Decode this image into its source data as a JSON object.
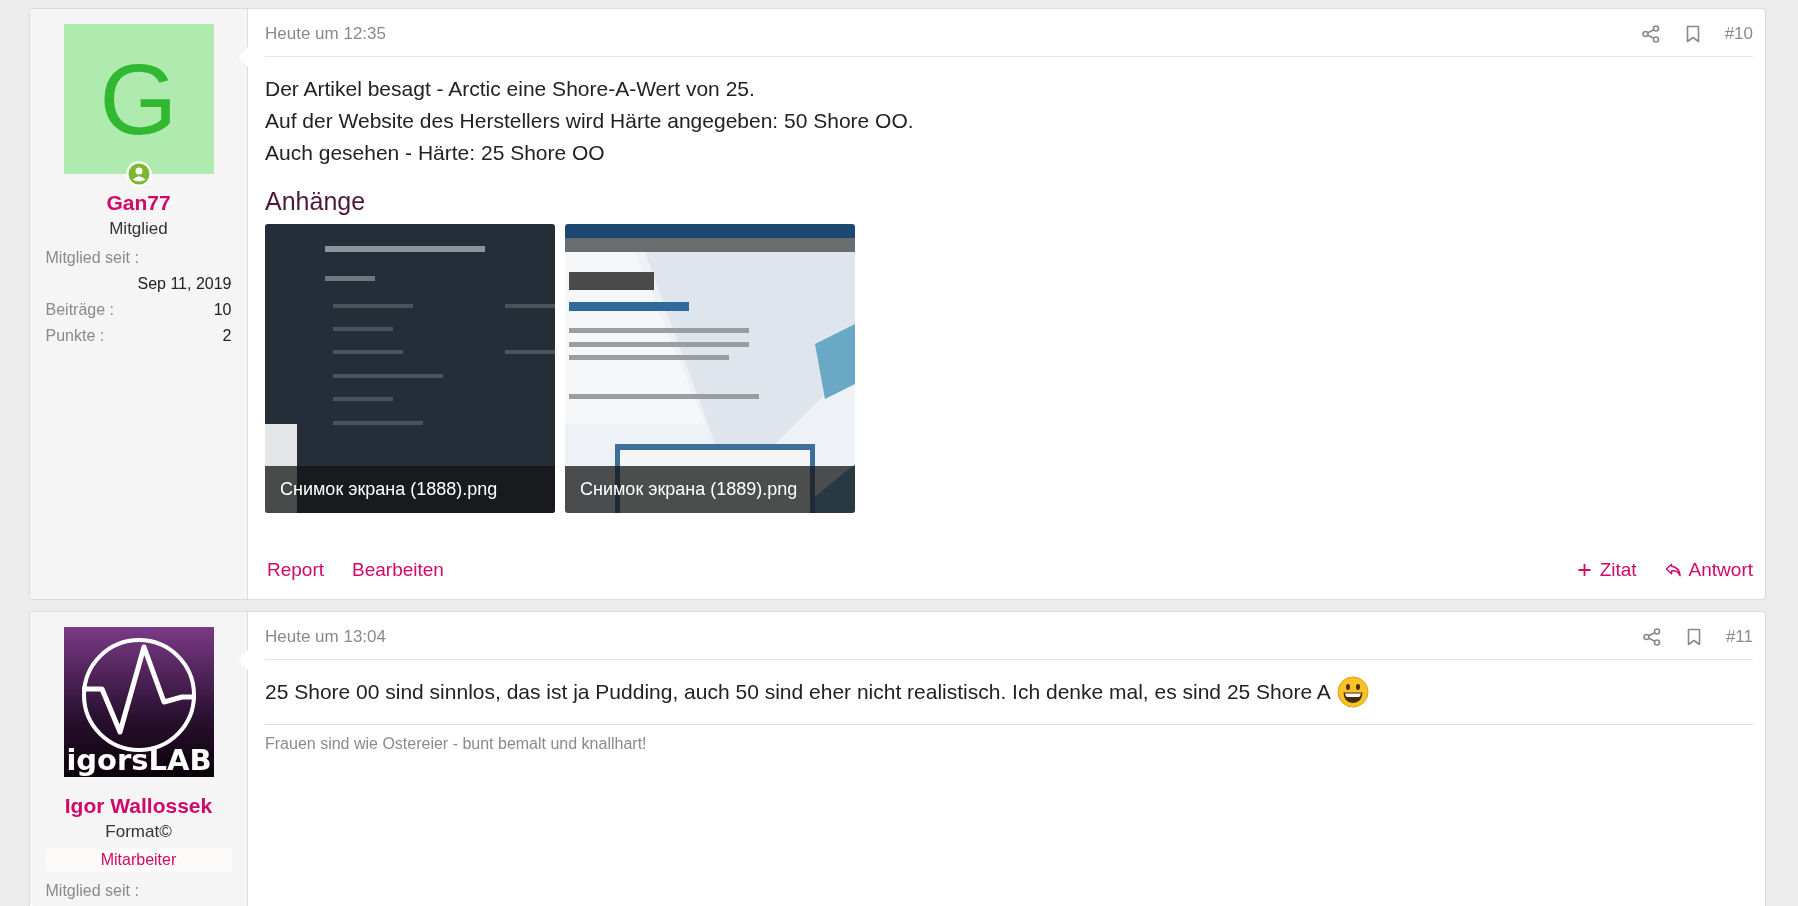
{
  "posts": [
    {
      "author": {
        "avatar": {
          "kind": "letter",
          "letter": "G",
          "online": true
        },
        "name": "Gan77",
        "title": "Mitglied",
        "stats": [
          {
            "label": "Mitglied seit :",
            "value": "Sep 11, 2019",
            "kind": "wide"
          },
          {
            "label": "Beiträge :",
            "value": "10",
            "kind": "inline"
          },
          {
            "label": "Punkte :",
            "value": "2",
            "kind": "inline"
          }
        ]
      },
      "time": "Heute um 12:35",
      "number": "#10",
      "paragraphs": [
        "Der Artikel besagt - Arctic eine Shore-A-Wert von 25.",
        "Auf der Website des Herstellers wird Härte angegeben: 50 Shore OO.",
        "Auch gesehen - Härte: 25 Shore OO"
      ],
      "attachments": {
        "heading": "Anhänge",
        "items": [
          {
            "name": "Снимок экрана (1888).png",
            "kind": "picture"
          },
          {
            "name": "Снимок экрана (1889).png",
            "kind": "picture"
          }
        ]
      },
      "actions_left": [
        "Report",
        "Bearbeiten"
      ],
      "actions_right": [
        {
          "label": "Zitat",
          "kind": "quote"
        },
        {
          "label": "Antwort",
          "kind": "reply"
        }
      ]
    },
    {
      "author": {
        "avatar": {
          "kind": "logo",
          "text": "igorsLAB"
        },
        "name": "Igor Wallossek",
        "title": "Format©",
        "badge": "Mitarbeiter",
        "stats": [
          {
            "label": "Mitglied seit :",
            "kind": "wide"
          }
        ]
      },
      "time": "Heute um 13:04",
      "number": "#11",
      "paragraphs": [
        "25 Shore 00 sind sinnlos, das ist ja Pudding, auch 50 sind eher nicht realistisch. Ich denke mal, es sind 25 Shore A"
      ],
      "emoji": true,
      "signature": "Frauen sind wie Ostereier - bunt bemalt und knallhart!"
    }
  ]
}
